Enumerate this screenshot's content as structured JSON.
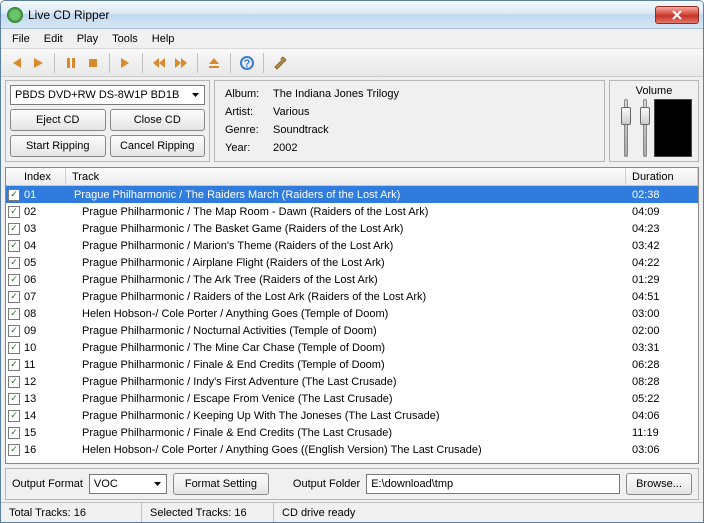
{
  "window": {
    "title": "Live CD Ripper"
  },
  "menu": {
    "file": "File",
    "edit": "Edit",
    "play": "Play",
    "tools": "Tools",
    "help": "Help"
  },
  "drive": {
    "selected": "PBDS DVD+RW DS-8W1P BD1B"
  },
  "buttons": {
    "eject": "Eject CD",
    "close_cd": "Close CD",
    "start_rip": "Start Ripping",
    "cancel_rip": "Cancel Ripping",
    "format_setting": "Format Setting",
    "browse": "Browse..."
  },
  "meta": {
    "album_lbl": "Album:",
    "album_val": "The Indiana Jones Trilogy",
    "artist_lbl": "Artist:",
    "artist_val": "Various",
    "genre_lbl": "Genre:",
    "genre_val": "Soundtrack",
    "year_lbl": "Year:",
    "year_val": "2002"
  },
  "volume": {
    "label": "Volume"
  },
  "columns": {
    "index": "Index",
    "track": "Track",
    "duration": "Duration"
  },
  "tracks": [
    {
      "n": "01",
      "t": "Prague Philharmonic / The Raiders March (Raiders of the Lost Ark)",
      "d": "02:38",
      "sel": true
    },
    {
      "n": "02",
      "t": "Prague Philharmonic / The Map Room - Dawn (Raiders of the Lost Ark)",
      "d": "04:09"
    },
    {
      "n": "03",
      "t": "Prague Philharmonic / The Basket Game (Raiders of the Lost Ark)",
      "d": "04:23"
    },
    {
      "n": "04",
      "t": "Prague Philharmonic / Marion's Theme (Raiders of the Lost Ark)",
      "d": "03:42"
    },
    {
      "n": "05",
      "t": "Prague Philharmonic / Airplane Flight (Raiders of the Lost Ark)",
      "d": "04:22"
    },
    {
      "n": "06",
      "t": "Prague Philharmonic / The Ark Tree (Raiders of the Lost Ark)",
      "d": "01:29"
    },
    {
      "n": "07",
      "t": "Prague Philharmonic / Raiders of the Lost Ark (Raiders of the Lost Ark)",
      "d": "04:51"
    },
    {
      "n": "08",
      "t": "Helen Hobson-/ Cole Porter / Anything Goes (Temple of Doom)",
      "d": "03:00"
    },
    {
      "n": "09",
      "t": "Prague Philharmonic / Nocturnal Activities (Temple of Doom)",
      "d": "02:00"
    },
    {
      "n": "10",
      "t": "Prague Philharmonic / The Mine Car Chase (Temple of Doom)",
      "d": "03:31"
    },
    {
      "n": "11",
      "t": "Prague Philharmonic / Finale & End Credits (Temple of Doom)",
      "d": "06:28"
    },
    {
      "n": "12",
      "t": "Prague Philharmonic / Indy's First Adventure (The Last Crusade)",
      "d": "08:28"
    },
    {
      "n": "13",
      "t": "Prague Philharmonic / Escape From Venice (The Last Crusade)",
      "d": "05:22"
    },
    {
      "n": "14",
      "t": "Prague Philharmonic / Keeping Up With The Joneses (The Last Crusade)",
      "d": "04:06"
    },
    {
      "n": "15",
      "t": "Prague Philharmonic / Finale & End Credits (The Last Crusade)",
      "d": "11:19"
    },
    {
      "n": "16",
      "t": "Helen Hobson-/ Cole Porter / Anything Goes ((English Version) The Last Crusade)",
      "d": "03:06"
    }
  ],
  "output": {
    "format_lbl": "Output Format",
    "format_val": "VOC",
    "folder_lbl": "Output Folder",
    "folder_val": "E:\\download\\tmp"
  },
  "status": {
    "total": "Total Tracks: 16",
    "selected": "Selected Tracks: 16",
    "drive": "CD drive ready"
  }
}
